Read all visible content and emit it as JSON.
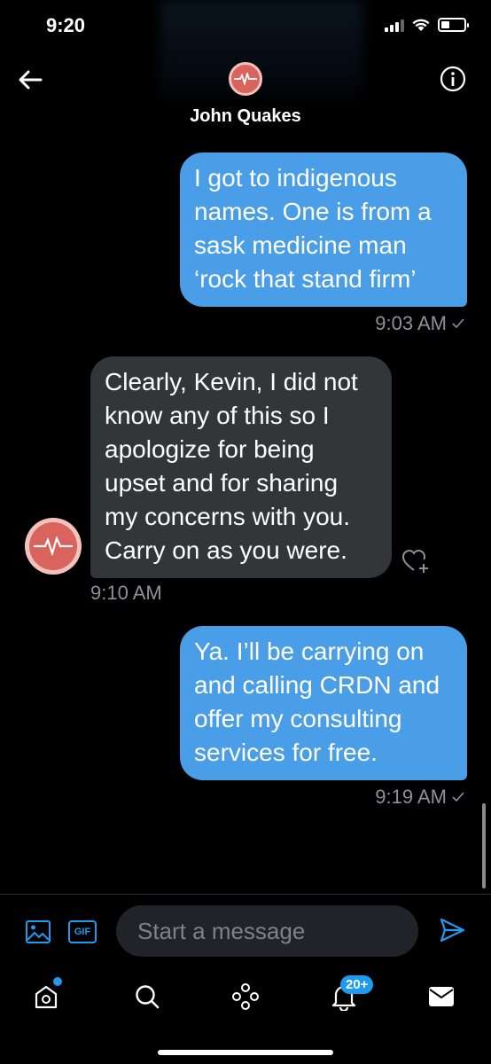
{
  "status_bar": {
    "time": "9:20"
  },
  "header": {
    "contact_name": "John Quakes"
  },
  "messages": [
    {
      "direction": "out",
      "text": "I got to indigenous\nnames.  One is from a\nsask medicine man\n‘rock that stand firm’",
      "time": "9:03 AM"
    },
    {
      "direction": "in",
      "text": "Clearly, Kevin, I did not\nknow any of this so I\napologize for being\nupset and for sharing\nmy concerns with you.\nCarry on as you were.",
      "time": "9:10 AM"
    },
    {
      "direction": "out",
      "text": "Ya. I’ll be carrying on\nand calling CRDN and\noffer my consulting\nservices for free.",
      "time": "9:19 AM"
    }
  ],
  "composer": {
    "placeholder": "Start a message",
    "gif_label": "GIF"
  },
  "tabbar": {
    "notifications_badge": "20+"
  },
  "colors": {
    "accent": "#1d9bf0",
    "bubble_out": "#4a9ee8",
    "bubble_in": "#333638",
    "avatar": "#d9645e"
  },
  "icons": [
    "back-arrow-icon",
    "info-icon",
    "heart-add-icon",
    "image-icon",
    "send-icon",
    "home-icon",
    "search-icon",
    "spaces-icon",
    "bell-icon",
    "mail-icon"
  ]
}
